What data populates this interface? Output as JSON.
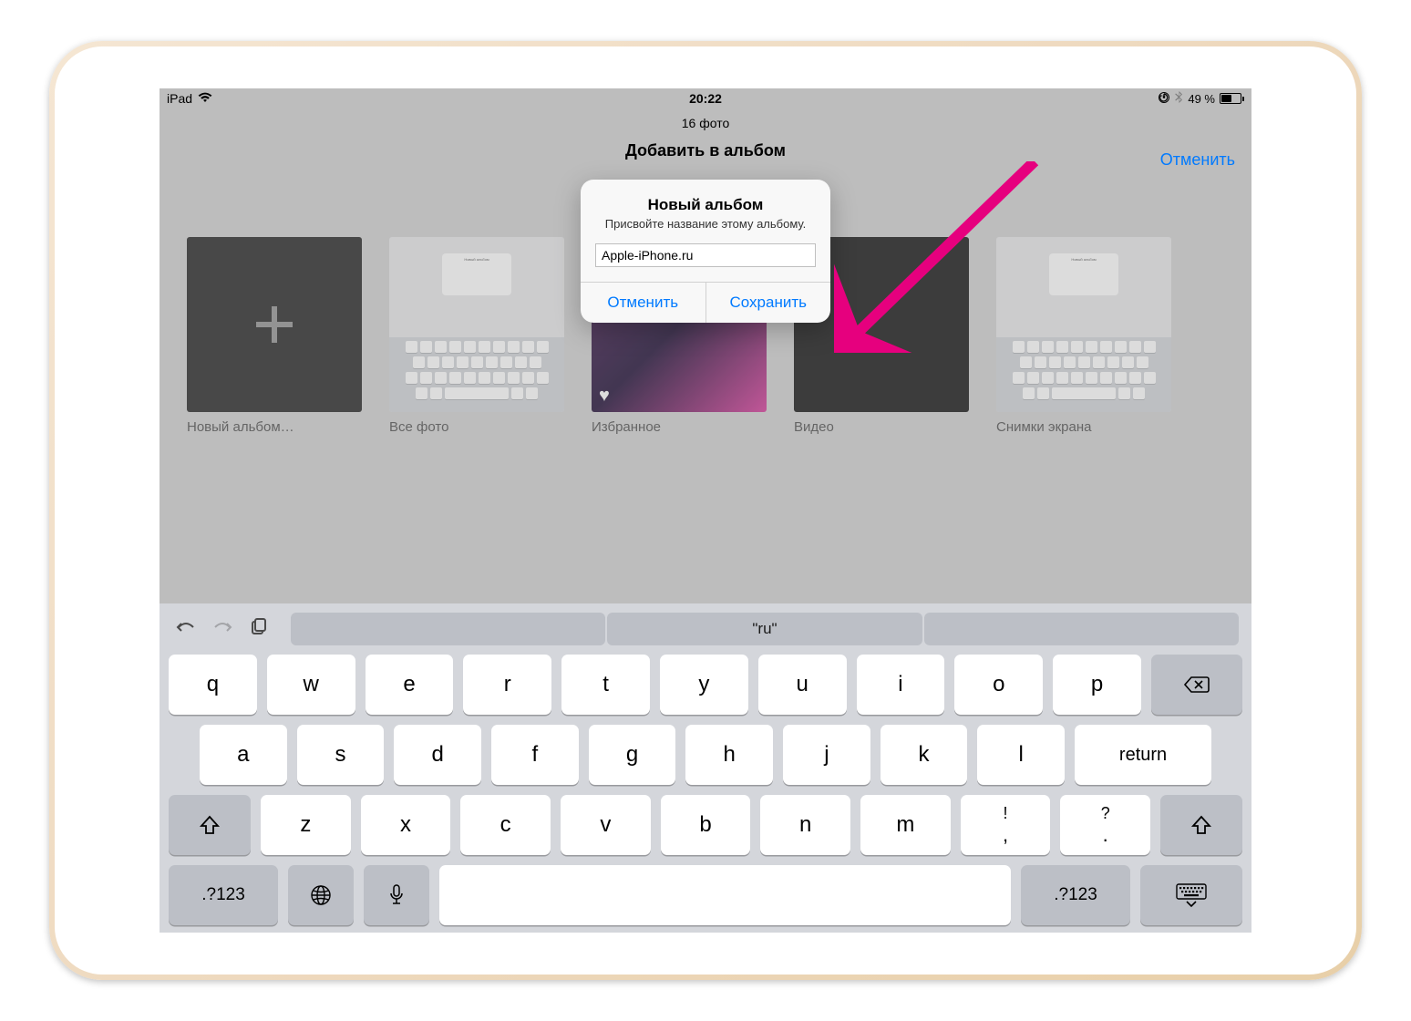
{
  "status": {
    "device": "iPad",
    "time": "20:22",
    "battery_percent": "49 %",
    "rotation_lock": "⦾",
    "bluetooth": "✱"
  },
  "header": {
    "photo_count": "16 фото",
    "title": "Добавить в альбом",
    "cancel": "Отменить"
  },
  "albums": [
    {
      "label": "Новый альбом…"
    },
    {
      "label": "Все фото"
    },
    {
      "label": "Избранное"
    },
    {
      "label": "Видео"
    },
    {
      "label": "Снимки экрана"
    }
  ],
  "alert": {
    "title": "Новый альбом",
    "subtitle": "Присвойте название этому альбому.",
    "input_value": "Apple-iPhone.ru",
    "cancel": "Отменить",
    "save": "Сохранить"
  },
  "keyboard": {
    "suggestion": "\"ru\"",
    "row1": [
      "q",
      "w",
      "e",
      "r",
      "t",
      "y",
      "u",
      "i",
      "o",
      "p"
    ],
    "row2": [
      "a",
      "s",
      "d",
      "f",
      "g",
      "h",
      "j",
      "k",
      "l"
    ],
    "row3": [
      "z",
      "x",
      "c",
      "v",
      "b",
      "n",
      "m"
    ],
    "punct1_top": "!",
    "punct1_bot": ",",
    "punct2_top": "?",
    "punct2_bot": ".",
    "return": "return",
    "numswitch": ".?123"
  }
}
